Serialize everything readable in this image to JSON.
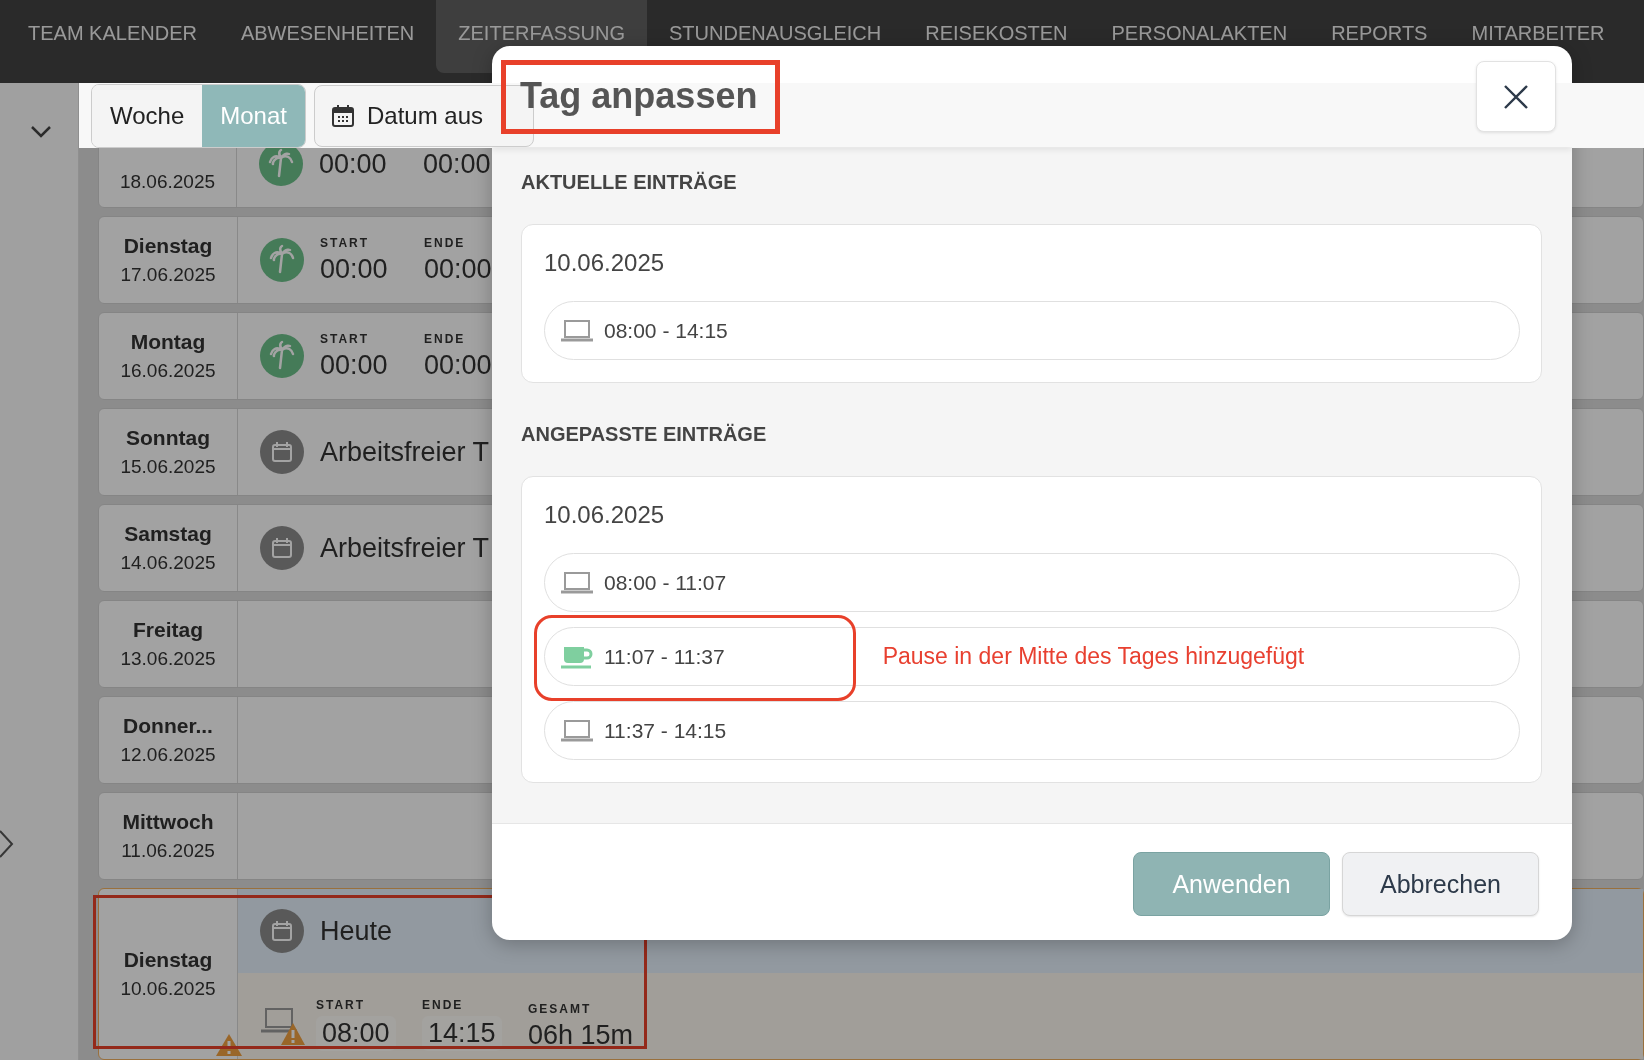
{
  "nav": [
    {
      "label": "TEAM KALENDER",
      "selected": false
    },
    {
      "label": "ABWESENHEITEN",
      "selected": false
    },
    {
      "label": "ZEITERFASSUNG",
      "selected": true
    },
    {
      "label": "STUNDENAUSGLEICH",
      "selected": false
    },
    {
      "label": "REISEKOSTEN",
      "selected": false
    },
    {
      "label": "PERSONALAKTEN",
      "selected": false
    },
    {
      "label": "REPORTS",
      "selected": false
    },
    {
      "label": "MITARBEITER",
      "selected": false
    }
  ],
  "toolbar": {
    "views": [
      {
        "label": "Woche",
        "selected": false
      },
      {
        "label": "Monat",
        "selected": true
      }
    ],
    "date_button": "Datum aus"
  },
  "days": [
    {
      "kind": "vacation",
      "date": "18.06.2025",
      "start": "00:00",
      "end": "00:00"
    },
    {
      "kind": "vacation",
      "weekday": "Dienstag",
      "date": "17.06.2025",
      "start_label": "START",
      "start": "00:00",
      "end_label": "ENDE",
      "end": "00:00"
    },
    {
      "kind": "vacation",
      "weekday": "Montag",
      "date": "16.06.2025",
      "start_label": "START",
      "start": "00:00",
      "end_label": "ENDE",
      "end": "00:00"
    },
    {
      "kind": "free",
      "weekday": "Sonntag",
      "date": "15.06.2025",
      "text": "Arbeitsfreier T"
    },
    {
      "kind": "free",
      "weekday": "Samstag",
      "date": "14.06.2025",
      "text": "Arbeitsfreier T"
    },
    {
      "kind": "empty",
      "weekday": "Freitag",
      "date": "13.06.2025"
    },
    {
      "kind": "empty",
      "weekday": "Donner...",
      "date": "12.06.2025"
    },
    {
      "kind": "empty",
      "weekday": "Mittwoch",
      "date": "11.06.2025"
    },
    {
      "kind": "today",
      "weekday": "Dienstag",
      "date": "10.06.2025",
      "note": "Heute",
      "warning": true,
      "highlighted": true,
      "start_label": "START",
      "start": "08:00",
      "end_label": "ENDE",
      "end": "14:15",
      "total_label": "GESAMT",
      "total": "06h 15m"
    }
  ],
  "modal": {
    "title": "Tag anpassen",
    "title_highlighted": true,
    "sections": [
      {
        "heading": "AKTUELLE EINTRÄGE",
        "date": "10.06.2025",
        "entries": [
          {
            "kind": "work",
            "time": "08:00 - 14:15",
            "highlighted": false
          }
        ]
      },
      {
        "heading": "ANGEPASSTE EINTRÄGE",
        "date": "10.06.2025",
        "entries": [
          {
            "kind": "work",
            "time": "08:00 - 11:07",
            "highlighted": false
          },
          {
            "kind": "break",
            "time": "11:07 - 11:37",
            "highlighted": true,
            "note": "Pause in der Mitte des Tages hinzugefügt"
          },
          {
            "kind": "work",
            "time": "11:37 - 14:15",
            "highlighted": false
          }
        ]
      }
    ],
    "buttons": [
      {
        "label": "Anwenden",
        "kind": "primary"
      },
      {
        "label": "Abbrechen",
        "kind": "secondary"
      }
    ]
  }
}
